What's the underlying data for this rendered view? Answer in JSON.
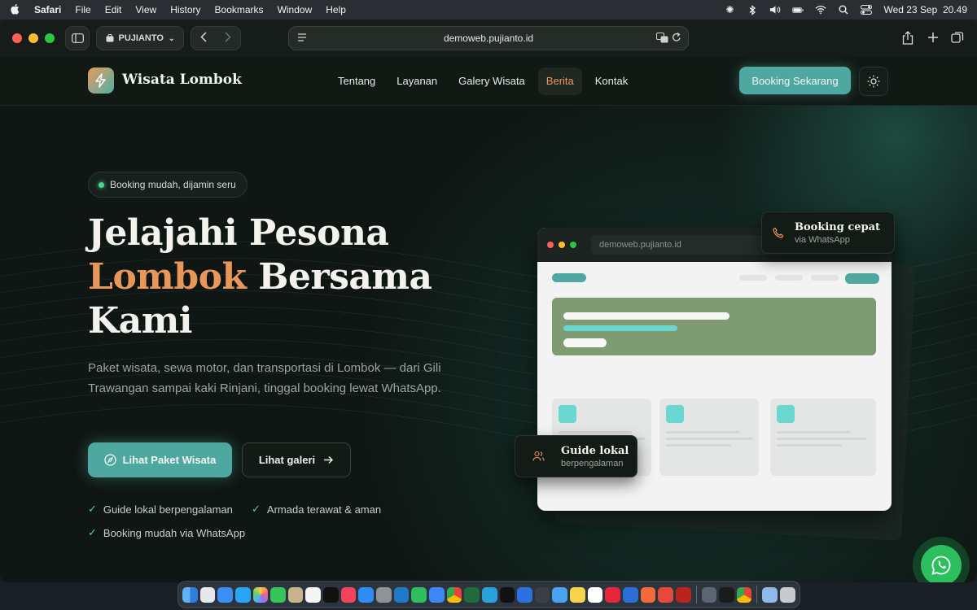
{
  "menubar": {
    "app": "Safari",
    "items": [
      "File",
      "Edit",
      "View",
      "History",
      "Bookmarks",
      "Window",
      "Help"
    ],
    "clock": "Wed 23 Sep  20.49"
  },
  "browser": {
    "profile": "PUJIANTO",
    "url": "demoweb.pujianto.id"
  },
  "site": {
    "brand": "Wisata Lombok",
    "nav": [
      {
        "label": "Tentang"
      },
      {
        "label": "Layanan"
      },
      {
        "label": "Galery Wisata"
      },
      {
        "label": "Berita",
        "active": true
      },
      {
        "label": "Kontak"
      }
    ],
    "booking_button": "Booking Sekarang"
  },
  "hero": {
    "pill": "Booking mudah, dijamin seru",
    "title_line1": "Jelajahi Pesona",
    "title_accent": "Lombok",
    "title_line2_rest": " Bersama",
    "title_line3": "Kami",
    "description": "Paket wisata, sewa motor, dan transportasi di Lombok — dari Gili Trawangan sampai kaki Rinjani, tinggal booking lewat WhatsApp.",
    "cta_primary": "Lihat Paket Wisata",
    "cta_secondary": "Lihat galeri",
    "features": [
      "Guide lokal berpengalaman",
      "Armada terawat & aman",
      "Booking mudah via WhatsApp"
    ]
  },
  "mockup": {
    "url": "demoweb.pujianto.id",
    "badge1_title": "Booking cepat",
    "badge1_sub": "via WhatsApp",
    "badge2_title": "Guide lokal",
    "badge2_sub": "berpengalaman"
  },
  "colors": {
    "accent_orange": "#e8975a",
    "accent_teal": "#4fa8a0",
    "whatsapp_green": "#2dbf5d",
    "background": "#0f1613"
  }
}
